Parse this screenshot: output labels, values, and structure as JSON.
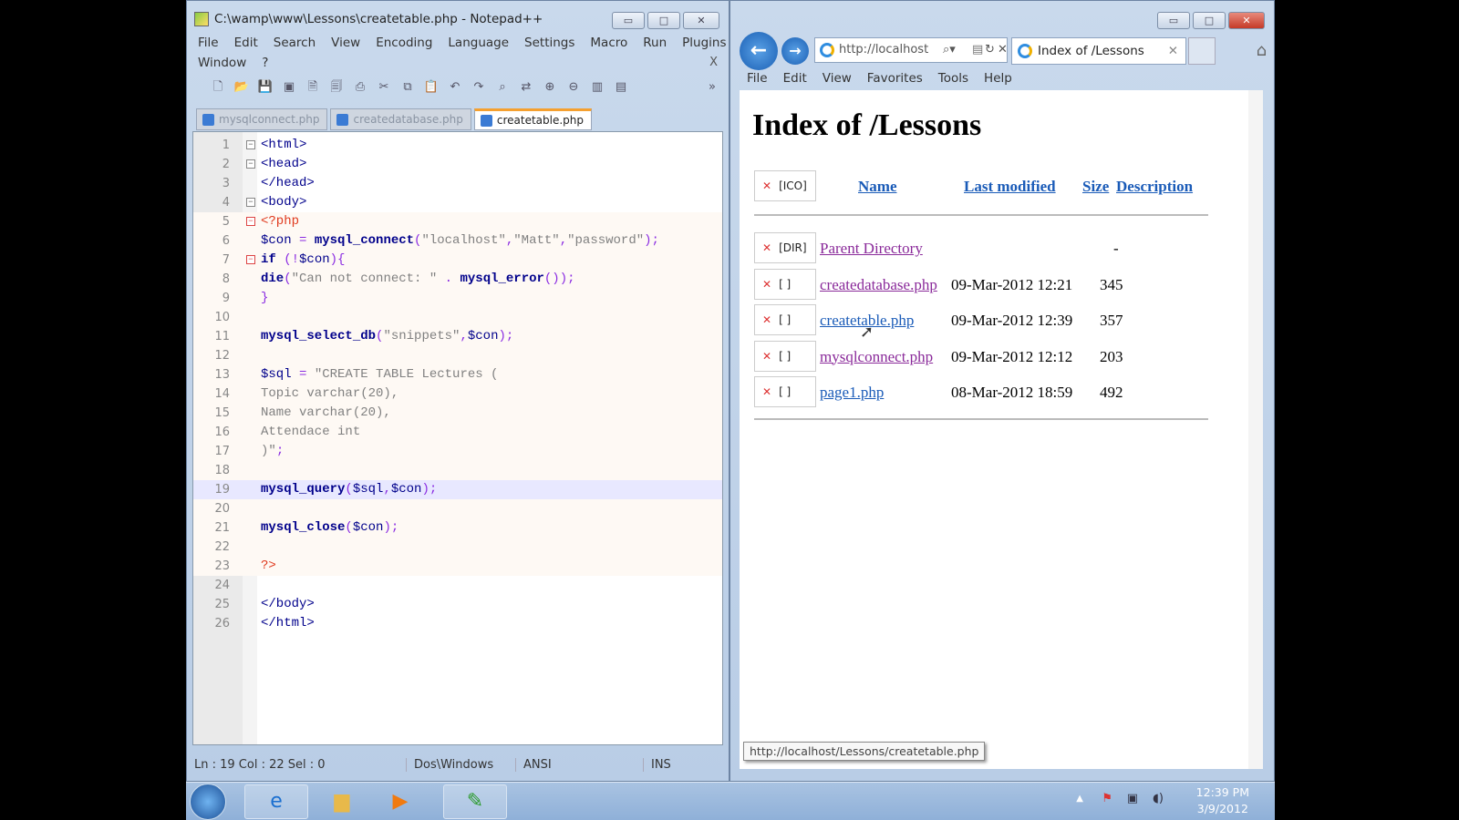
{
  "notepad": {
    "title": "C:\\wamp\\www\\Lessons\\createtable.php - Notepad++",
    "menu": [
      "File",
      "Edit",
      "Search",
      "View",
      "Encoding",
      "Language",
      "Settings",
      "Macro",
      "Run",
      "Plugins"
    ],
    "menu2": [
      "Window",
      "?"
    ],
    "close_doc": "X",
    "toolbar": [
      "new-file",
      "open-file",
      "save",
      "save-all",
      "close",
      "close-all",
      "print",
      "cut",
      "copy",
      "paste",
      "undo",
      "redo",
      "find",
      "replace",
      "zoom-in",
      "zoom-out",
      "sync-v",
      "sync-h"
    ],
    "toolbar_more": "»",
    "tabs": [
      {
        "label": "mysqlconnect.php"
      },
      {
        "label": "createdatabase.php"
      },
      {
        "label": "createtable.php",
        "active": true
      }
    ],
    "lines": [
      {
        "n": "1",
        "fold": "box",
        "tokens": [
          {
            "t": "<html>",
            "k": "tag"
          }
        ]
      },
      {
        "n": "2",
        "fold": "box",
        "tokens": [
          {
            "t": "<head>",
            "k": "tag"
          }
        ]
      },
      {
        "n": "3",
        "tokens": [
          {
            "t": "</head>",
            "k": "tag"
          }
        ]
      },
      {
        "n": "4",
        "fold": "box",
        "tokens": [
          {
            "t": "<body>",
            "k": "tag"
          }
        ]
      },
      {
        "n": "5",
        "fold": "red",
        "php": true,
        "tokens": [
          {
            "t": "<?php",
            "k": "php"
          }
        ]
      },
      {
        "n": "6",
        "php": true,
        "tokens": [
          {
            "t": "$con",
            "k": "var"
          },
          {
            "t": " = ",
            "k": "op"
          },
          {
            "t": "mysql_connect",
            "k": "fn"
          },
          {
            "t": "(",
            "k": "op"
          },
          {
            "t": "\"localhost\"",
            "k": "str"
          },
          {
            "t": ",",
            "k": "op"
          },
          {
            "t": "\"Matt\"",
            "k": "str"
          },
          {
            "t": ",",
            "k": "op"
          },
          {
            "t": "\"password\"",
            "k": "str"
          },
          {
            "t": ");",
            "k": "op"
          }
        ]
      },
      {
        "n": "7",
        "fold": "red",
        "php": true,
        "tokens": [
          {
            "t": "if",
            "k": "kw"
          },
          {
            "t": " (!",
            "k": "op"
          },
          {
            "t": "$con",
            "k": "var"
          },
          {
            "t": "){",
            "k": "op"
          }
        ]
      },
      {
        "n": "8",
        "php": true,
        "tokens": [
          {
            "t": "die",
            "k": "kw"
          },
          {
            "t": "(",
            "k": "op"
          },
          {
            "t": "\"Can not connect: \"",
            "k": "str"
          },
          {
            "t": " . ",
            "k": "op"
          },
          {
            "t": "mysql_error",
            "k": "fn"
          },
          {
            "t": "());",
            "k": "op"
          }
        ]
      },
      {
        "n": "9",
        "php": true,
        "tokens": [
          {
            "t": "}",
            "k": "op"
          }
        ]
      },
      {
        "n": "10",
        "php": true,
        "tokens": []
      },
      {
        "n": "11",
        "php": true,
        "tokens": [
          {
            "t": "mysql_select_db",
            "k": "fn"
          },
          {
            "t": "(",
            "k": "op"
          },
          {
            "t": "\"snippets\"",
            "k": "str"
          },
          {
            "t": ",",
            "k": "op"
          },
          {
            "t": "$con",
            "k": "var"
          },
          {
            "t": ");",
            "k": "op"
          }
        ]
      },
      {
        "n": "12",
        "php": true,
        "tokens": []
      },
      {
        "n": "13",
        "php": true,
        "tokens": [
          {
            "t": "$sql",
            "k": "var"
          },
          {
            "t": " = ",
            "k": "op"
          },
          {
            "t": "\"CREATE TABLE Lectures (",
            "k": "str"
          }
        ]
      },
      {
        "n": "14",
        "php": true,
        "tokens": [
          {
            "t": "Topic varchar(20),",
            "k": "str"
          }
        ]
      },
      {
        "n": "15",
        "php": true,
        "tokens": [
          {
            "t": "Name varchar(20),",
            "k": "str"
          }
        ]
      },
      {
        "n": "16",
        "php": true,
        "tokens": [
          {
            "t": "Attendace int",
            "k": "str"
          }
        ]
      },
      {
        "n": "17",
        "php": true,
        "tokens": [
          {
            "t": ")\"",
            "k": "str"
          },
          {
            "t": ";",
            "k": "op"
          }
        ]
      },
      {
        "n": "18",
        "php": true,
        "tokens": []
      },
      {
        "n": "19",
        "php": true,
        "cur": true,
        "tokens": [
          {
            "t": "mysql_query",
            "k": "fn"
          },
          {
            "t": "(",
            "k": "op"
          },
          {
            "t": "$sql",
            "k": "var"
          },
          {
            "t": ",",
            "k": "op"
          },
          {
            "t": "$con",
            "k": "var"
          },
          {
            "t": ");",
            "k": "op"
          }
        ]
      },
      {
        "n": "20",
        "php": true,
        "tokens": []
      },
      {
        "n": "21",
        "php": true,
        "tokens": [
          {
            "t": "mysql_close",
            "k": "fn"
          },
          {
            "t": "(",
            "k": "op"
          },
          {
            "t": "$con",
            "k": "var"
          },
          {
            "t": ");",
            "k": "op"
          }
        ]
      },
      {
        "n": "22",
        "php": true,
        "tokens": []
      },
      {
        "n": "23",
        "php": true,
        "tokens": [
          {
            "t": "?>",
            "k": "php"
          }
        ]
      },
      {
        "n": "24",
        "tokens": []
      },
      {
        "n": "25",
        "tokens": [
          {
            "t": "</body>",
            "k": "tag"
          }
        ]
      },
      {
        "n": "26",
        "tokens": [
          {
            "t": "</html>",
            "k": "tag"
          }
        ]
      }
    ],
    "status": {
      "pos": "Ln : 19    Col : 22    Sel : 0",
      "eol": "Dos\\Windows",
      "encoding": "ANSI",
      "mode": "INS"
    }
  },
  "ie": {
    "address": "http://localhost",
    "tab_title": "Index of /Lessons",
    "menu": [
      "File",
      "Edit",
      "View",
      "Favorites",
      "Tools",
      "Help"
    ],
    "heading": "Index of /Lessons",
    "header": {
      "icon": "[ICO]",
      "name": "Name",
      "modified": "Last modified",
      "size": "Size",
      "desc": "Description"
    },
    "rows": [
      {
        "icon": "[DIR]",
        "name": "Parent Directory",
        "modified": "",
        "size": "-",
        "visited": true
      },
      {
        "icon": "[ ]",
        "name": "createdatabase.php",
        "modified": "09-Mar-2012 12:21",
        "size": "345",
        "visited": true
      },
      {
        "icon": "[ ]",
        "name": "createtable.php",
        "modified": "09-Mar-2012 12:39",
        "size": "357",
        "visited": false
      },
      {
        "icon": "[ ]",
        "name": "mysqlconnect.php",
        "modified": "09-Mar-2012 12:12",
        "size": "203",
        "visited": true
      },
      {
        "icon": "[ ]",
        "name": "page1.php",
        "modified": "08-Mar-2012 18:59",
        "size": "492",
        "visited": false
      }
    ],
    "status_url": "http://localhost/Lessons/createtable.php"
  },
  "taskbar": {
    "apps": [
      "internet-explorer",
      "windows-explorer",
      "media-player",
      "notepad-plus-plus"
    ],
    "time": "12:39 PM",
    "date": "3/9/2012"
  }
}
